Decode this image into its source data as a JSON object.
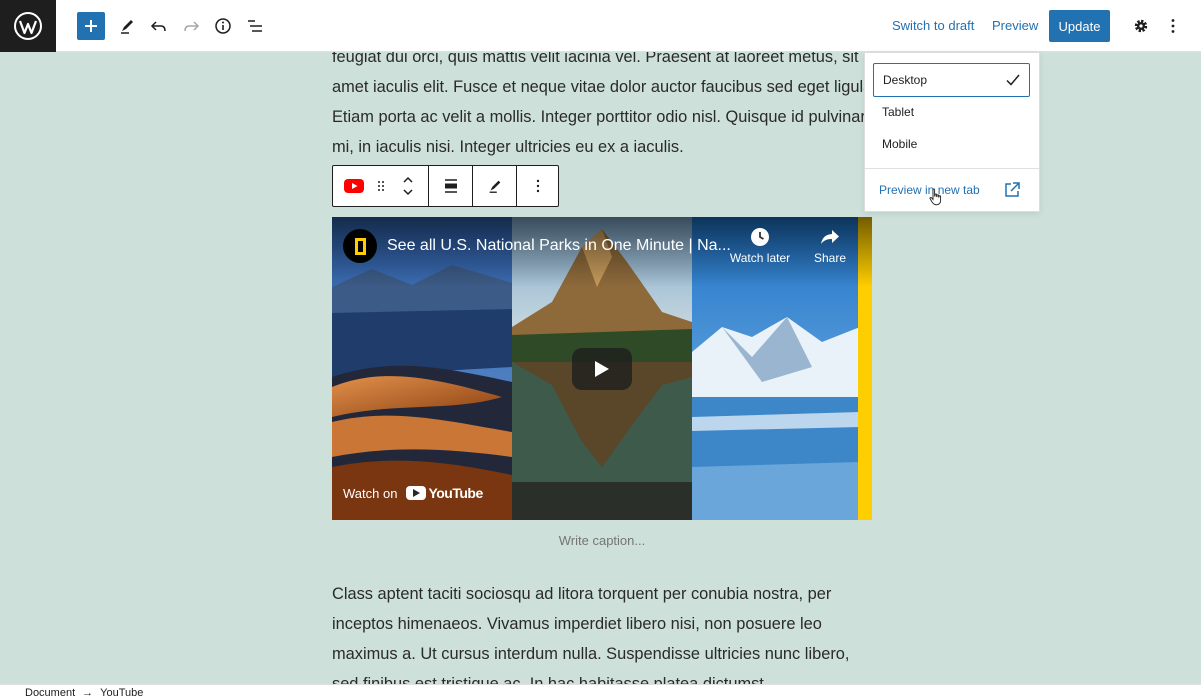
{
  "topbar": {
    "switch_to_draft": "Switch to draft",
    "preview": "Preview",
    "update": "Update"
  },
  "content": {
    "paragraph_top": "feugiat dui orci, quis mattis velit iacinia vel. Praesent at laoreet metus, sit amet iaculis elit. Fusce et neque vitae dolor auctor faucibus sed eget ligula. Etiam porta ac velit a mollis. Integer porttitor odio nisl. Quisque id pulvinar mi, in iaculis nisi. Integer ultricies eu ex a iaculis.",
    "paragraph_bottom": "Class aptent taciti sociosqu ad litora torquent per conubia nostra, per inceptos himenaeos. Vivamus imperdiet libero nisi, non posuere leo maximus a. Ut cursus interdum nulla. Suspendisse ultricies nunc libero, sed finibus est tristique ac. In hac habitasse platea dictumst.",
    "caption_placeholder": "Write caption..."
  },
  "embed": {
    "video_title": "See all U.S. National Parks in One Minute | Na...",
    "watch_later": "Watch later",
    "share": "Share",
    "watch_on": "Watch on",
    "youtube": "YouTube"
  },
  "preview_menu": {
    "desktop": "Desktop",
    "tablet": "Tablet",
    "mobile": "Mobile",
    "preview_new_tab": "Preview in new tab",
    "selected": "Desktop"
  },
  "breadcrumb": {
    "items": [
      "Document",
      "YouTube"
    ]
  },
  "colors": {
    "accent": "#2271b1",
    "canvas_bg": "#cde0d9",
    "youtube_red": "#ff0000",
    "natgeo_yellow": "#ffce00"
  }
}
